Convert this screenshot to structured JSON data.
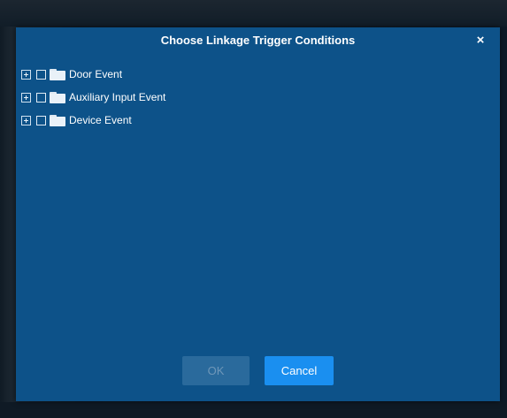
{
  "dialog": {
    "title": "Choose Linkage Trigger Conditions",
    "close_glyph": "×",
    "close_icon": "close-icon"
  },
  "tree": {
    "items": [
      {
        "label": "Door Event",
        "expanded": false,
        "checked": false,
        "icon": "folder-icon"
      },
      {
        "label": "Auxiliary Input Event",
        "expanded": false,
        "checked": false,
        "icon": "folder-icon"
      },
      {
        "label": "Device Event",
        "expanded": false,
        "checked": false,
        "icon": "folder-icon"
      }
    ]
  },
  "buttons": {
    "ok_label": "OK",
    "ok_disabled": true,
    "cancel_label": "Cancel"
  },
  "colors": {
    "dialog_bg": "#0d5289",
    "primary": "#1a8ff0",
    "disabled_btn": "#2a6a9c"
  }
}
